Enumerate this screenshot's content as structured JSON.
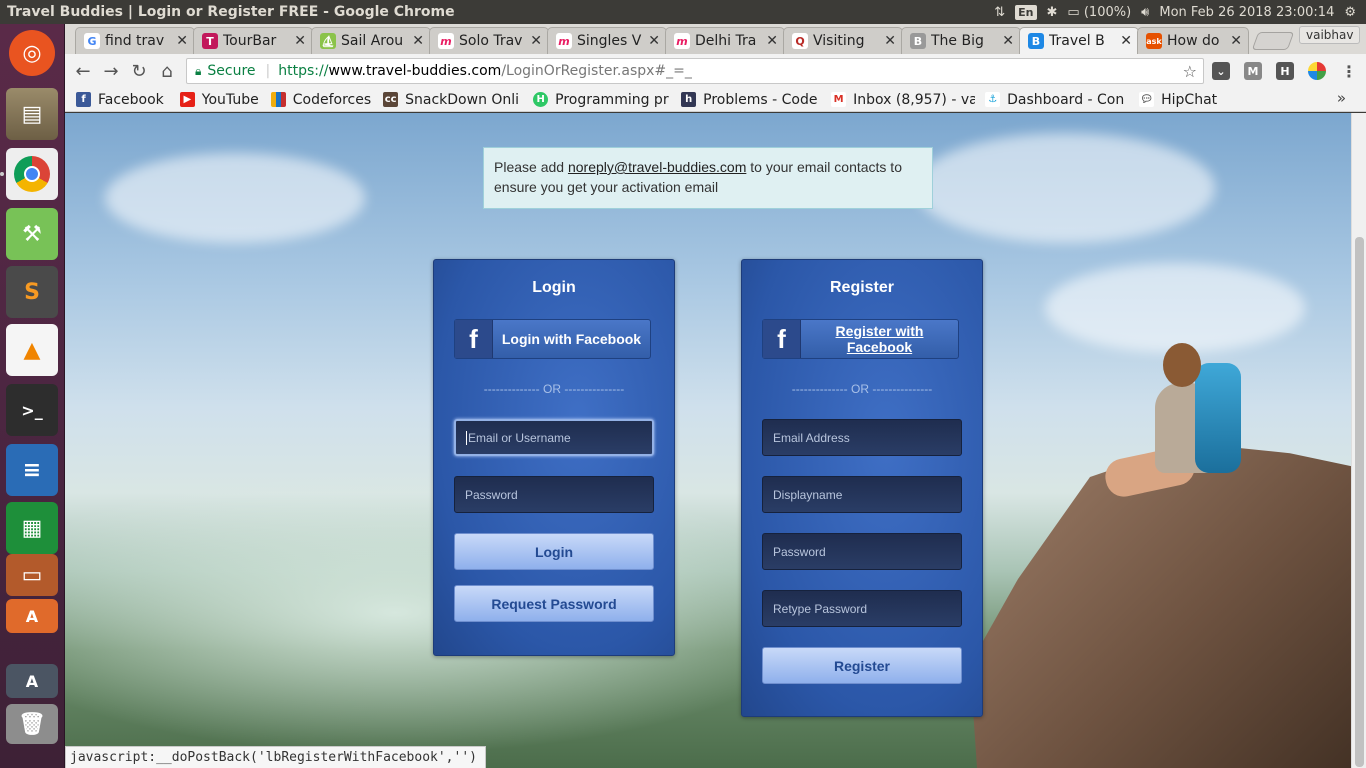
{
  "window": {
    "title": "Travel Buddies | Login or Register FREE - Google Chrome"
  },
  "system_tray": {
    "keyboard": "En",
    "battery": "(100%)",
    "datetime": "Mon Feb 26 2018 23:00:14"
  },
  "tabs": [
    {
      "label": "find trav",
      "favicon": "google-icon",
      "color": "#4285f4"
    },
    {
      "label": "TourBar",
      "favicon": "tourbar-icon",
      "color": "#c2185b"
    },
    {
      "label": "Sail Arou",
      "favicon": "sail-icon",
      "color": "#8bc34a"
    },
    {
      "label": "Solo Trav",
      "favicon": "m-icon",
      "color": "#e91e63"
    },
    {
      "label": "Singles V",
      "favicon": "m-icon",
      "color": "#e91e63"
    },
    {
      "label": "Delhi Tra",
      "favicon": "m-icon",
      "color": "#e91e63"
    },
    {
      "label": "Visiting",
      "favicon": "quora-icon",
      "color": "#b92b27"
    },
    {
      "label": "The Big",
      "favicon": "bigtravel-icon",
      "color": "#777777"
    },
    {
      "label": "Travel B",
      "favicon": "travelbuddies-icon",
      "color": "#1e88e5",
      "active": true
    },
    {
      "label": "How do",
      "favicon": "ask-icon",
      "color": "#e65100"
    }
  ],
  "profile": {
    "name": "vaibhav"
  },
  "omnibox": {
    "secure_label": "Secure",
    "url_scheme": "https://",
    "url_host": "www.travel-buddies.com",
    "url_path": "/LoginOrRegister.aspx#_=_"
  },
  "bookmarks": [
    {
      "label": "Facebook",
      "icon": "facebook-icon",
      "color": "#3b5998"
    },
    {
      "label": "YouTube",
      "icon": "youtube-icon",
      "color": "#e62117"
    },
    {
      "label": "Codeforces",
      "icon": "codeforces-icon",
      "color": "#f0ad0f"
    },
    {
      "label": "SnackDown Onli",
      "icon": "codechef-icon",
      "color": "#5b4638"
    },
    {
      "label": "Programming pr",
      "icon": "hackerrank-icon",
      "color": "#2ec866"
    },
    {
      "label": "Problems - Code",
      "icon": "hackerearth-icon",
      "color": "#323754"
    },
    {
      "label": "Inbox (8,957) - va",
      "icon": "gmail-icon",
      "color": "#d93025"
    },
    {
      "label": "Dashboard - Con",
      "icon": "dashboard-icon",
      "color": "#1aa3d9"
    },
    {
      "label": "HipChat",
      "icon": "hipchat-icon",
      "color": "#555555"
    }
  ],
  "page": {
    "notice": {
      "before": "Please add ",
      "email": "noreply@travel-buddies.com",
      "after": " to your email contacts to ensure you get your activation email"
    },
    "login": {
      "title": "Login",
      "fb_label": "Login with Facebook",
      "or_text": "-------------- OR ---------------",
      "username_placeholder": "Email or Username",
      "password_placeholder": "Password",
      "login_button": "Login",
      "request_password_button": "Request Password"
    },
    "register": {
      "title": "Register",
      "fb_label": "Register with Facebook",
      "or_text": "-------------- OR ---------------",
      "email_placeholder": "Email Address",
      "displayname_placeholder": "Displayname",
      "password_placeholder": "Password",
      "retype_placeholder": "Retype Password",
      "register_button": "Register"
    }
  },
  "status_bar": {
    "text": "javascript:__doPostBack('lbRegisterWithFacebook','')"
  }
}
